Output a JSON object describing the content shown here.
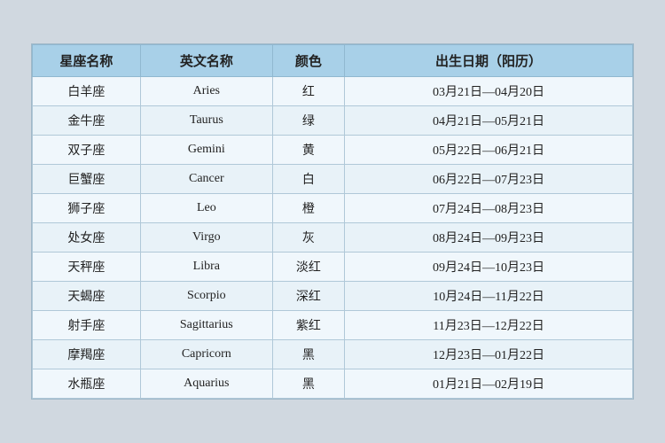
{
  "table": {
    "headers": {
      "chinese_name": "星座名称",
      "english_name": "英文名称",
      "color": "颜色",
      "birth_date": "出生日期（阳历）"
    },
    "rows": [
      {
        "chinese": "白羊座",
        "english": "Aries",
        "color": "红",
        "date": "03月21日—04月20日"
      },
      {
        "chinese": "金牛座",
        "english": "Taurus",
        "color": "绿",
        "date": "04月21日—05月21日"
      },
      {
        "chinese": "双子座",
        "english": "Gemini",
        "color": "黄",
        "date": "05月22日—06月21日"
      },
      {
        "chinese": "巨蟹座",
        "english": "Cancer",
        "color": "白",
        "date": "06月22日—07月23日"
      },
      {
        "chinese": "狮子座",
        "english": "Leo",
        "color": "橙",
        "date": "07月24日—08月23日"
      },
      {
        "chinese": "处女座",
        "english": "Virgo",
        "color": "灰",
        "date": "08月24日—09月23日"
      },
      {
        "chinese": "天秤座",
        "english": "Libra",
        "color": "淡红",
        "date": "09月24日—10月23日"
      },
      {
        "chinese": "天蝎座",
        "english": "Scorpio",
        "color": "深红",
        "date": "10月24日—11月22日"
      },
      {
        "chinese": "射手座",
        "english": "Sagittarius",
        "color": "紫红",
        "date": "11月23日—12月22日"
      },
      {
        "chinese": "摩羯座",
        "english": "Capricorn",
        "color": "黑",
        "date": "12月23日—01月22日"
      },
      {
        "chinese": "水瓶座",
        "english": "Aquarius",
        "color": "黑",
        "date": "01月21日—02月19日"
      }
    ]
  }
}
